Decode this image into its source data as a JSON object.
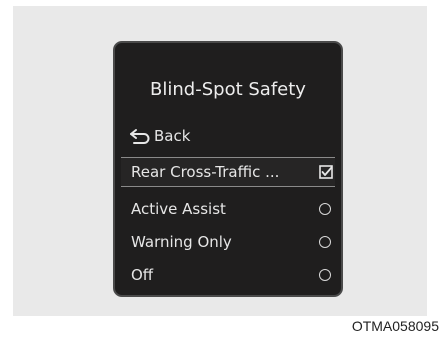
{
  "menu": {
    "title": "Blind-Spot Safety",
    "back_label": "Back",
    "items": [
      {
        "label": "Rear Cross-Traffic ...",
        "control": "checkbox",
        "checked": true,
        "selected": true
      },
      {
        "label": "Active Assist",
        "control": "radio",
        "checked": false
      },
      {
        "label": "Warning Only",
        "control": "radio",
        "checked": false
      },
      {
        "label": "Off",
        "control": "radio",
        "checked": false
      }
    ]
  },
  "caption": "OTMA058095",
  "colors": {
    "panel_bg": "#1f1e1e",
    "panel_border": "#4a4a4a",
    "frame_bg": "#e9e9e9",
    "text": "#e6e6e6"
  },
  "icons": {
    "back": "return-arrow-icon",
    "checkbox": "checkbox-checked-icon",
    "radio": "radio-unselected-icon"
  }
}
